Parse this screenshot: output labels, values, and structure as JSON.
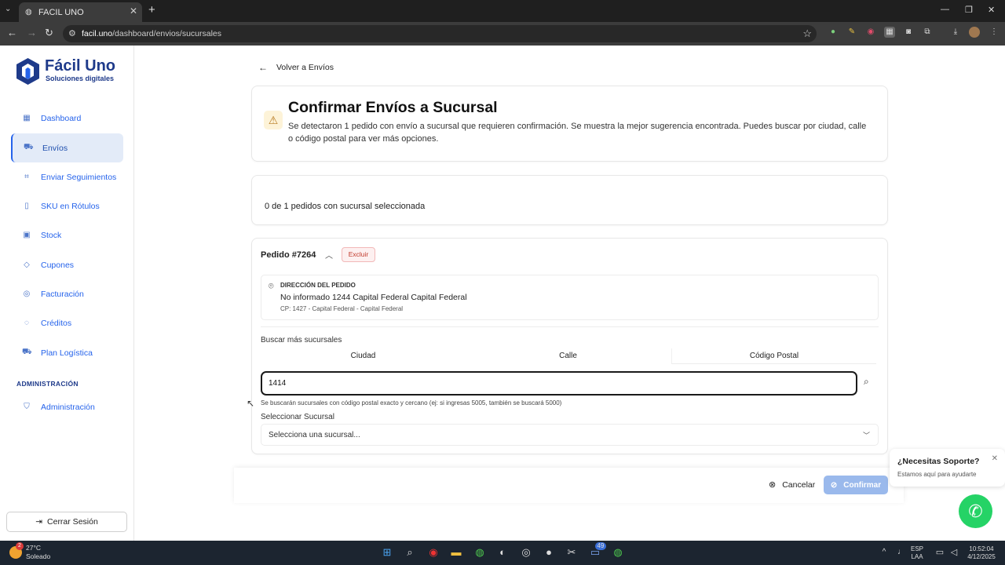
{
  "browser": {
    "tab_title": "FACIL UNO",
    "url_host": "facil.uno",
    "url_path": "/dashboard/envios/sucursales"
  },
  "sidebar": {
    "brand_title": "Fácil Uno",
    "brand_subtitle": "Soluciones digitales",
    "items": [
      {
        "label": "Dashboard",
        "icon": "grid-icon"
      },
      {
        "label": "Envíos",
        "icon": "truck-icon",
        "active": true
      },
      {
        "label": "Enviar Seguimientos",
        "icon": "scan-icon"
      },
      {
        "label": "SKU en Rótulos",
        "icon": "document-icon"
      },
      {
        "label": "Stock",
        "icon": "box-icon"
      },
      {
        "label": "Cupones",
        "icon": "tag-icon"
      },
      {
        "label": "Facturación",
        "icon": "receipt-icon"
      },
      {
        "label": "Créditos",
        "icon": "coins-icon"
      },
      {
        "label": "Plan Logística",
        "icon": "truck-icon"
      }
    ],
    "admin_section": "ADMINISTRACIÓN",
    "admin_item": "Administración",
    "logout": "Cerrar Sesión"
  },
  "main": {
    "back_label": "Volver a Envíos",
    "title": "Confirmar Envíos a Sucursal",
    "description": "Se detectaron 1 pedido con envío a sucursal que requieren confirmación. Se muestra la mejor sugerencia encontrada. Puedes buscar por ciudad, calle o código postal para ver más opciones.",
    "selection_status": "0 de 1 pedidos con sucursal seleccionada",
    "order": {
      "title": "Pedido #7264",
      "exclude_label": "Excluir",
      "address_heading": "DIRECCIÓN DEL PEDIDO",
      "address_line": "No informado 1244 Capital Federal Capital Federal",
      "address_cp": "CP: 1427 - Capital Federal - Capital Federal",
      "search_label": "Buscar más sucursales",
      "search_tabs": [
        "Ciudad",
        "Calle",
        "Código Postal"
      ],
      "search_value": "1414",
      "search_hint": "Se buscarán sucursales con código postal exacto y cercano (ej: si ingresas 5005, también se buscará 5000)",
      "select_label": "Seleccionar Sucursal",
      "select_placeholder": "Selecciona una sucursal..."
    },
    "cancel_label": "Cancelar",
    "confirm_label": "Confirmar"
  },
  "support": {
    "title": "¿Necesitas Soporte?",
    "subtitle": "Estamos aquí para ayudarte"
  },
  "taskbar": {
    "temperature": "27°C",
    "weather": "Soleado",
    "weather_badge": "2",
    "lang1": "ESP",
    "lang2": "LAA",
    "time": "10:52:04",
    "date": "4/12/2025",
    "chrome_badge": "49"
  },
  "colors": {
    "accent": "#2563eb",
    "brand": "#1e3a8a",
    "confirm_disabled": "#9ab9ec",
    "whatsapp": "#25d366"
  }
}
